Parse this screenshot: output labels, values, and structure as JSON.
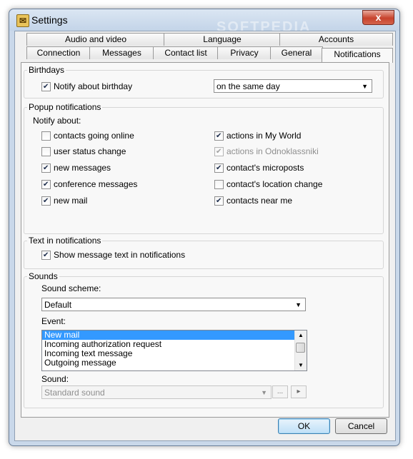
{
  "window": {
    "title": "Settings",
    "close_symbol": "x",
    "watermark": "SOFTPEDIA"
  },
  "tabs_row1": [
    "Audio and video",
    "Language",
    "Accounts"
  ],
  "tabs_row2": [
    "Connection",
    "Messages",
    "Contact list",
    "Privacy",
    "General",
    "Notifications"
  ],
  "birthdays": {
    "label": "Birthdays",
    "notify_label": "Notify about birthday",
    "notify_checked": true,
    "when_value": "on the same day"
  },
  "popup": {
    "label": "Popup notifications",
    "notify_about": "Notify about:",
    "left": [
      {
        "label": "contacts going online",
        "checked": false,
        "disabled": false
      },
      {
        "label": "user status change",
        "checked": false,
        "disabled": false
      },
      {
        "label": "new messages",
        "checked": true,
        "disabled": false
      },
      {
        "label": "conference messages",
        "checked": true,
        "disabled": false
      },
      {
        "label": "new mail",
        "checked": true,
        "disabled": false
      }
    ],
    "right": [
      {
        "label": "actions in My World",
        "checked": true,
        "disabled": false
      },
      {
        "label": "actions in Odnoklassniki",
        "checked": true,
        "disabled": true
      },
      {
        "label": "contact's microposts",
        "checked": true,
        "disabled": false
      },
      {
        "label": "contact's location change",
        "checked": false,
        "disabled": false
      },
      {
        "label": "contacts near me",
        "checked": true,
        "disabled": false
      }
    ]
  },
  "text_notifications": {
    "label": "Text in notifications",
    "show_text_label": "Show message text in notifications",
    "show_text_checked": true
  },
  "sounds": {
    "label": "Sounds",
    "scheme_label": "Sound scheme:",
    "scheme_value": "Default",
    "event_label": "Event:",
    "events": [
      "New mail",
      "Incoming authorization request",
      "Incoming text message",
      "Outgoing message"
    ],
    "selected_event": "New mail",
    "sound_label": "Sound:",
    "sound_value": "Standard sound",
    "browse_label": "...",
    "play_label": "▸"
  },
  "buttons": {
    "ok": "OK",
    "cancel": "Cancel"
  }
}
